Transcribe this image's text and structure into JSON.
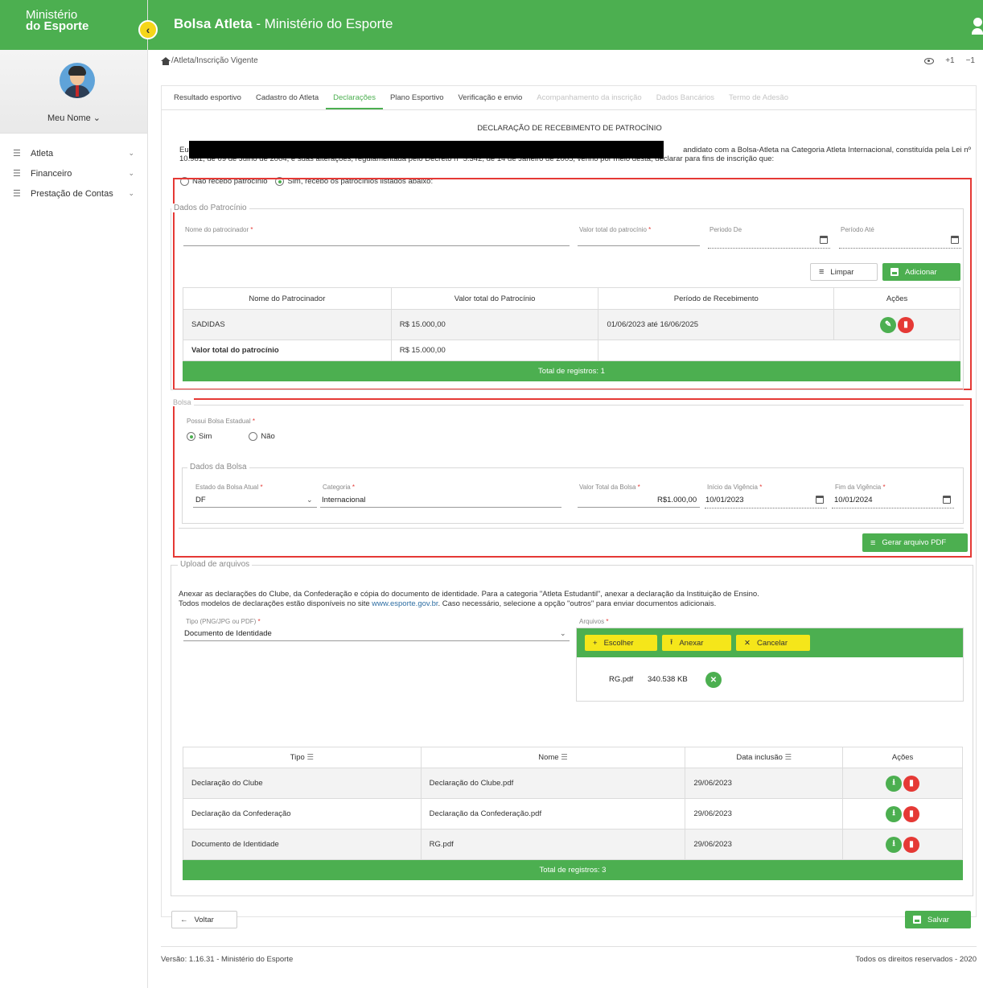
{
  "brand": {
    "line1": "Ministério",
    "line2": "do Esporte"
  },
  "app_title": {
    "bold": "Bolsa Atleta",
    "rest": " - Ministério do Esporte"
  },
  "profile": {
    "name": "Meu Nome ⌄"
  },
  "nav": [
    {
      "label": "Atleta"
    },
    {
      "label": "Financeiro"
    },
    {
      "label": "Prestação de Contas"
    }
  ],
  "breadcrumb": "/Atleta/Inscrição Vigente",
  "zoom": {
    "plus": "+1",
    "minus": "−1"
  },
  "tabs": [
    {
      "label": "Resultado esportivo",
      "state": "normal"
    },
    {
      "label": "Cadastro do Atleta",
      "state": "normal"
    },
    {
      "label": "Declarações",
      "state": "active"
    },
    {
      "label": "Plano Esportivo",
      "state": "normal"
    },
    {
      "label": "Verificação e envio",
      "state": "normal"
    },
    {
      "label": "Acompanhamento da inscrição",
      "state": "disabled"
    },
    {
      "label": "Dados Bancários",
      "state": "disabled"
    },
    {
      "label": "Termo de Adesão",
      "state": "disabled"
    }
  ],
  "declaration": {
    "title": "DECLARAÇÃO DE RECEBIMENTO DE PATROCÍNIO",
    "line1_start": "Eu,",
    "line1_end": "andidato com a Bolsa-Atleta na Categoria Atleta Internacional, constituída pela Lei nº",
    "line2": "10.981, de 09 de Julho de 2004, e suas alterações, regulamentada pelo Decreto nº 5.342, de 14 de Janeiro de 2005, venho por meio desta, declarar para fins de inscrição que:",
    "radio_no": "Não recebo patrocínio",
    "radio_yes": "Sim, recebo os patrocínios listados abaixo:"
  },
  "sponsor": {
    "legend": "Dados do Patrocínio",
    "name_label": "Nome do patrocinador",
    "value_label": "Valor total do patrocínio",
    "from_label": "Periodo De",
    "to_label": "Período Até",
    "clear_label": "Limpar",
    "add_label": "Adicionar",
    "table_headers": [
      "Nome do Patrocinador",
      "Valor total do Patrocínio",
      "Período de Recebimento",
      "Ações"
    ],
    "rows": [
      {
        "name": "SADIDAS",
        "value": "R$ 15.000,00",
        "period": "01/06/2023 até 16/06/2025"
      }
    ],
    "total_label": "Valor total do patrocínio",
    "total_value": "R$ 15.000,00",
    "records": "Total de registros: 1"
  },
  "bolsa": {
    "legend": "Bolsa",
    "question": "Possui Bolsa Estadual",
    "yes": "Sim",
    "no": "Não",
    "sub_legend": "Dados da Bolsa",
    "state_label": "Estado da Bolsa Atual",
    "state_value": "DF",
    "category_label": "Categoria",
    "category_value": "Internacional",
    "value_label": "Valor Total da Bolsa",
    "value_value": "R$1.000,00",
    "start_label": "Início da Vigência",
    "start_value": "10/01/2023",
    "end_label": "Fim da Vigência",
    "end_value": "10/01/2024",
    "pdf_label": "Gerar arquivo PDF"
  },
  "upload": {
    "legend": "Upload de arquivos",
    "info1": "Anexar as declarações do Clube, da Confederação e cópia do documento de identidade. Para a categoria \"Atleta Estudantil\", anexar a declaração da Instituição de Ensino.",
    "info2_a": "Todos modelos de declarações estão disponíveis no site ",
    "info2_link": "www.esporte.gov.br",
    "info2_b": ". Caso necessário, selecione a opção \"outros\" para enviar documentos adicionais.",
    "type_label": "Tipo (PNG/JPG ou PDF)",
    "type_value": "Documento de Identidade",
    "files_label": "Arquivos",
    "choose": "Escolher",
    "attach": "Anexar",
    "cancel": "Cancelar",
    "file_name": "RG.pdf",
    "file_size": "340.538 KB",
    "table_headers": [
      "Tipo",
      "Nome",
      "Data inclusão",
      "Ações"
    ],
    "rows": [
      {
        "tipo": "Declaração do Clube",
        "nome": "Declaração do Clube.pdf",
        "data": "29/06/2023"
      },
      {
        "tipo": "Declaração da Confederação",
        "nome": "Declaração da Confederação.pdf",
        "data": "29/06/2023"
      },
      {
        "tipo": "Documento de Identidade",
        "nome": "RG.pdf",
        "data": "29/06/2023"
      }
    ],
    "records": "Total de registros: 3"
  },
  "actions": {
    "back": "Voltar",
    "save": "Salvar"
  },
  "footer": {
    "version": "Versão: 1.16.31 - Ministério do Esporte",
    "rights": "Todos os direitos reservados - 2020"
  },
  "colors": {
    "primary": "#4caf50",
    "danger": "#e53935",
    "accent": "#f5e61a",
    "highlight_box": "#e53935"
  }
}
